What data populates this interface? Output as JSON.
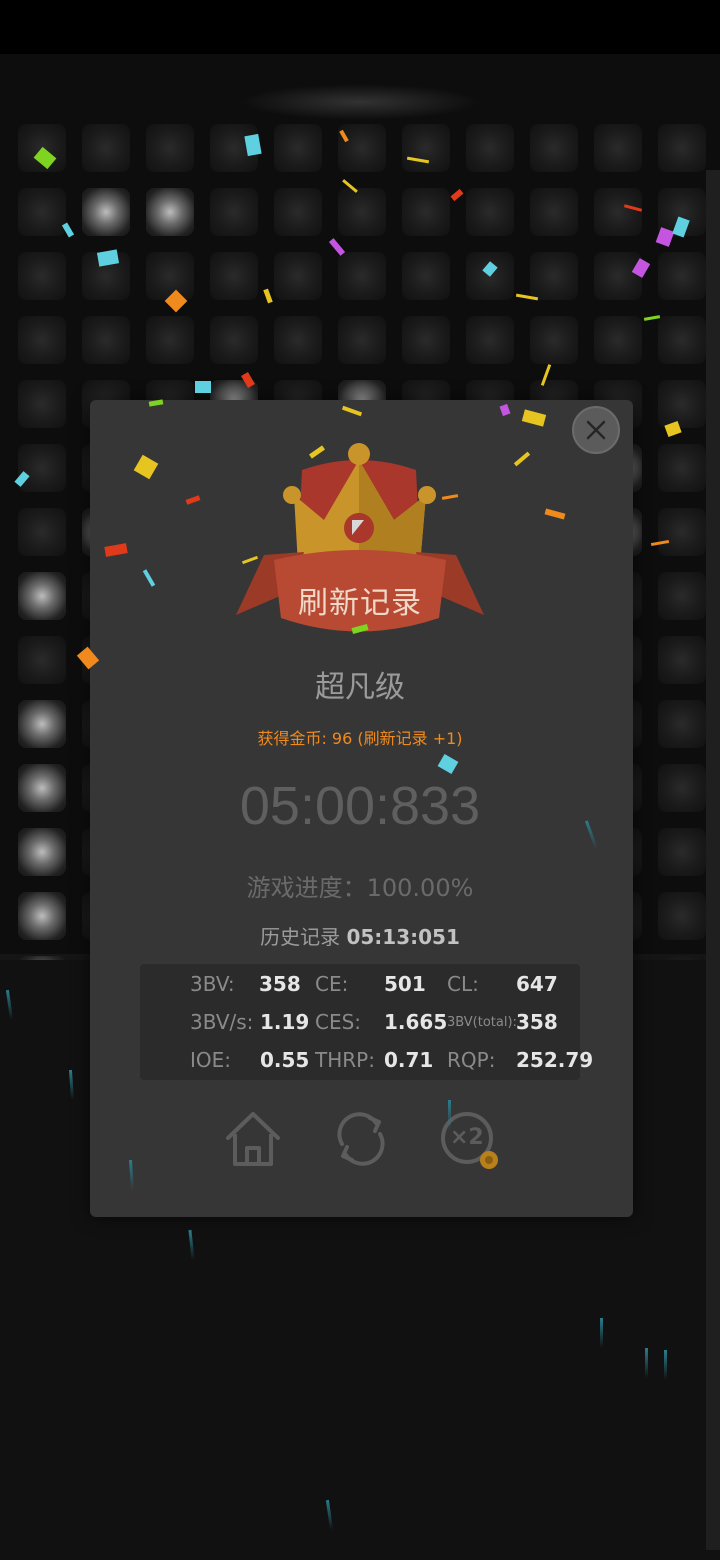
{
  "record_badge": {
    "label": "刷新记录"
  },
  "difficulty": {
    "label": "超凡级"
  },
  "reward": {
    "text": "获得金币: 96 (刷新记录 +1)"
  },
  "timer": {
    "value": "05:00:833"
  },
  "progress": {
    "text": "游戏进度：100.00%"
  },
  "history": {
    "label": "历史记录",
    "value": "05:13:051"
  },
  "stats": {
    "bv_label": "3BV:",
    "bv_value": "358",
    "ce_label": "CE:",
    "ce_value": "501",
    "cl_label": "CL:",
    "cl_value": "647",
    "bvs_label": "3BV/s:",
    "bvs_value": "1.19",
    "ces_label": "CES:",
    "ces_value": "1.665",
    "bvtotal_label": "3BV(total):",
    "bvtotal_value": "358",
    "ioe_label": "IOE:",
    "ioe_value": "0.55",
    "thrp_label": "THRP:",
    "thrp_value": "0.71",
    "rqp_label": "RQP:",
    "rqp_value": "252.79"
  },
  "actions": {
    "home_icon": "home-icon",
    "restart_icon": "refresh-icon",
    "double_icon": "double-reward-icon",
    "double_label": "×2"
  },
  "colors": {
    "modal_bg": "#363636",
    "accent_orange": "#f08a1d",
    "ribbon_red": "#b84a34",
    "crown_gold": "#c9952a"
  }
}
